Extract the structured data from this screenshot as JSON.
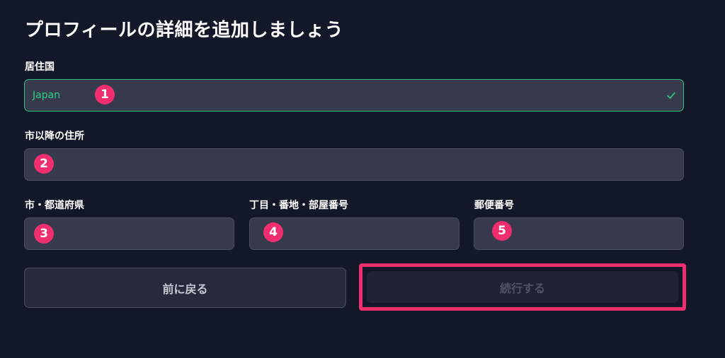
{
  "page": {
    "title": "プロフィールの詳細を追加しましょう"
  },
  "fields": {
    "country": {
      "label": "居住国",
      "value": "Japan",
      "badge": "1"
    },
    "address": {
      "label": "市以降の住所",
      "value": "",
      "badge": "2"
    },
    "city": {
      "label": "市・都道府県",
      "value": "",
      "badge": "3"
    },
    "street": {
      "label": "丁目・番地・部屋番号",
      "value": "",
      "badge": "4"
    },
    "postal": {
      "label": "郵便番号",
      "value": "",
      "badge": "5"
    }
  },
  "buttons": {
    "back_label": "前に戻る",
    "continue_label": "続行する"
  },
  "colors": {
    "background": "#131829",
    "field_bg": "#373a4c",
    "valid_border": "#2fbf7c",
    "badge": "#ef2e6f",
    "highlight": "#ef2e6f"
  },
  "icons": {
    "valid": "check-icon"
  }
}
